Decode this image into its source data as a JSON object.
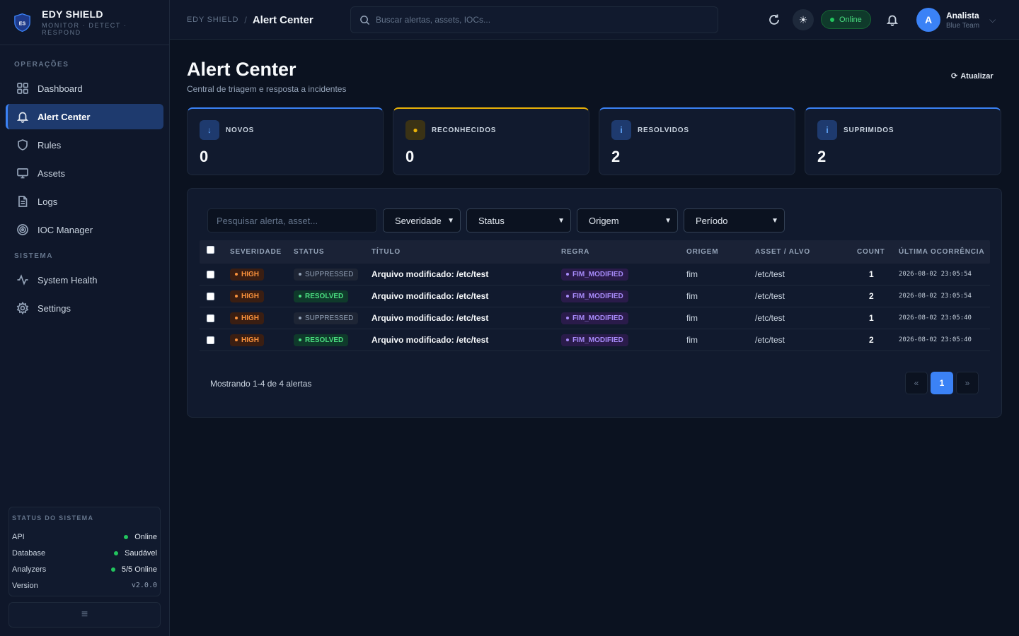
{
  "brand": {
    "name": "EDY SHIELD",
    "tagline": "MONITOR · DETECT · RESPOND",
    "logo_text": "ES"
  },
  "sidebar": {
    "section_ops": "OPERAÇÕES",
    "section_sys": "SISTEMA",
    "items": [
      {
        "label": "Dashboard",
        "icon": "grid-icon"
      },
      {
        "label": "Alert Center",
        "icon": "bell-icon",
        "active": true
      },
      {
        "label": "Rules",
        "icon": "shield-icon"
      },
      {
        "label": "Assets",
        "icon": "monitor-icon"
      },
      {
        "label": "Logs",
        "icon": "file-icon"
      },
      {
        "label": "IOC Manager",
        "icon": "target-icon"
      }
    ],
    "sys_items": [
      {
        "label": "System Health",
        "icon": "activity-icon"
      },
      {
        "label": "Settings",
        "icon": "gear-icon"
      }
    ],
    "status": {
      "title": "STATUS DO SISTEMA",
      "rows": [
        {
          "label": "API",
          "value": "Online"
        },
        {
          "label": "Database",
          "value": "Saudável"
        },
        {
          "label": "Analyzers",
          "value": "5/5 Online"
        },
        {
          "label": "Version",
          "value": "v2.0.0"
        }
      ]
    }
  },
  "topbar": {
    "breadcrumb_root": "EDY SHIELD",
    "breadcrumb_sep": "/",
    "breadcrumb_current": "Alert Center",
    "search_placeholder": "Buscar alertas, assets, IOCs...",
    "online_label": "Online",
    "user_initial": "A",
    "user_name": "Analista",
    "user_role": "Blue Team"
  },
  "page": {
    "title": "Alert Center",
    "subtitle": "Central de triagem e resposta a incidentes",
    "refresh_label": "Atualizar"
  },
  "stats": [
    {
      "label": "NOVOS",
      "value": "0",
      "icon": "↓"
    },
    {
      "label": "RECONHECIDOS",
      "value": "0",
      "icon": "●"
    },
    {
      "label": "RESOLVIDOS",
      "value": "2",
      "icon": "i"
    },
    {
      "label": "SUPRIMIDOS",
      "value": "2",
      "icon": "i"
    }
  ],
  "filters": {
    "search_placeholder": "Pesquisar alerta, asset...",
    "severity": "Severidade",
    "status": "Status",
    "origin": "Origem",
    "period": "Período"
  },
  "table": {
    "headers": [
      "SEVERIDADE",
      "STATUS",
      "TÍTULO",
      "REGRA",
      "ORIGEM",
      "ASSET / ALVO",
      "COUNT",
      "ÚLTIMA OCORRÊNCIA"
    ],
    "rows": [
      {
        "severity": "HIGH",
        "status": "SUPPRESSED",
        "title": "Arquivo modificado: /etc/test",
        "rule": "FIM_MODIFIED",
        "origin": "fim",
        "asset": "/etc/test",
        "count": "1",
        "last": "2026-08-02 23:05:54"
      },
      {
        "severity": "HIGH",
        "status": "RESOLVED",
        "title": "Arquivo modificado: /etc/test",
        "rule": "FIM_MODIFIED",
        "origin": "fim",
        "asset": "/etc/test",
        "count": "2",
        "last": "2026-08-02 23:05:54"
      },
      {
        "severity": "HIGH",
        "status": "SUPPRESSED",
        "title": "Arquivo modificado: /etc/test",
        "rule": "FIM_MODIFIED",
        "origin": "fim",
        "asset": "/etc/test",
        "count": "1",
        "last": "2026-08-02 23:05:40"
      },
      {
        "severity": "HIGH",
        "status": "RESOLVED",
        "title": "Arquivo modificado: /etc/test",
        "rule": "FIM_MODIFIED",
        "origin": "fim",
        "asset": "/etc/test",
        "count": "2",
        "last": "2026-08-02 23:05:40"
      }
    ]
  },
  "pagination": {
    "info": "Mostrando 1-4 de 4 alertas",
    "prev": "«",
    "current": "1",
    "next": "»"
  },
  "colors": {
    "accent": "#3b82f6",
    "success": "#22c55e",
    "warning": "#eab308",
    "high": "#fb923c",
    "rule": "#a78bfa",
    "background": "#0b1220"
  }
}
